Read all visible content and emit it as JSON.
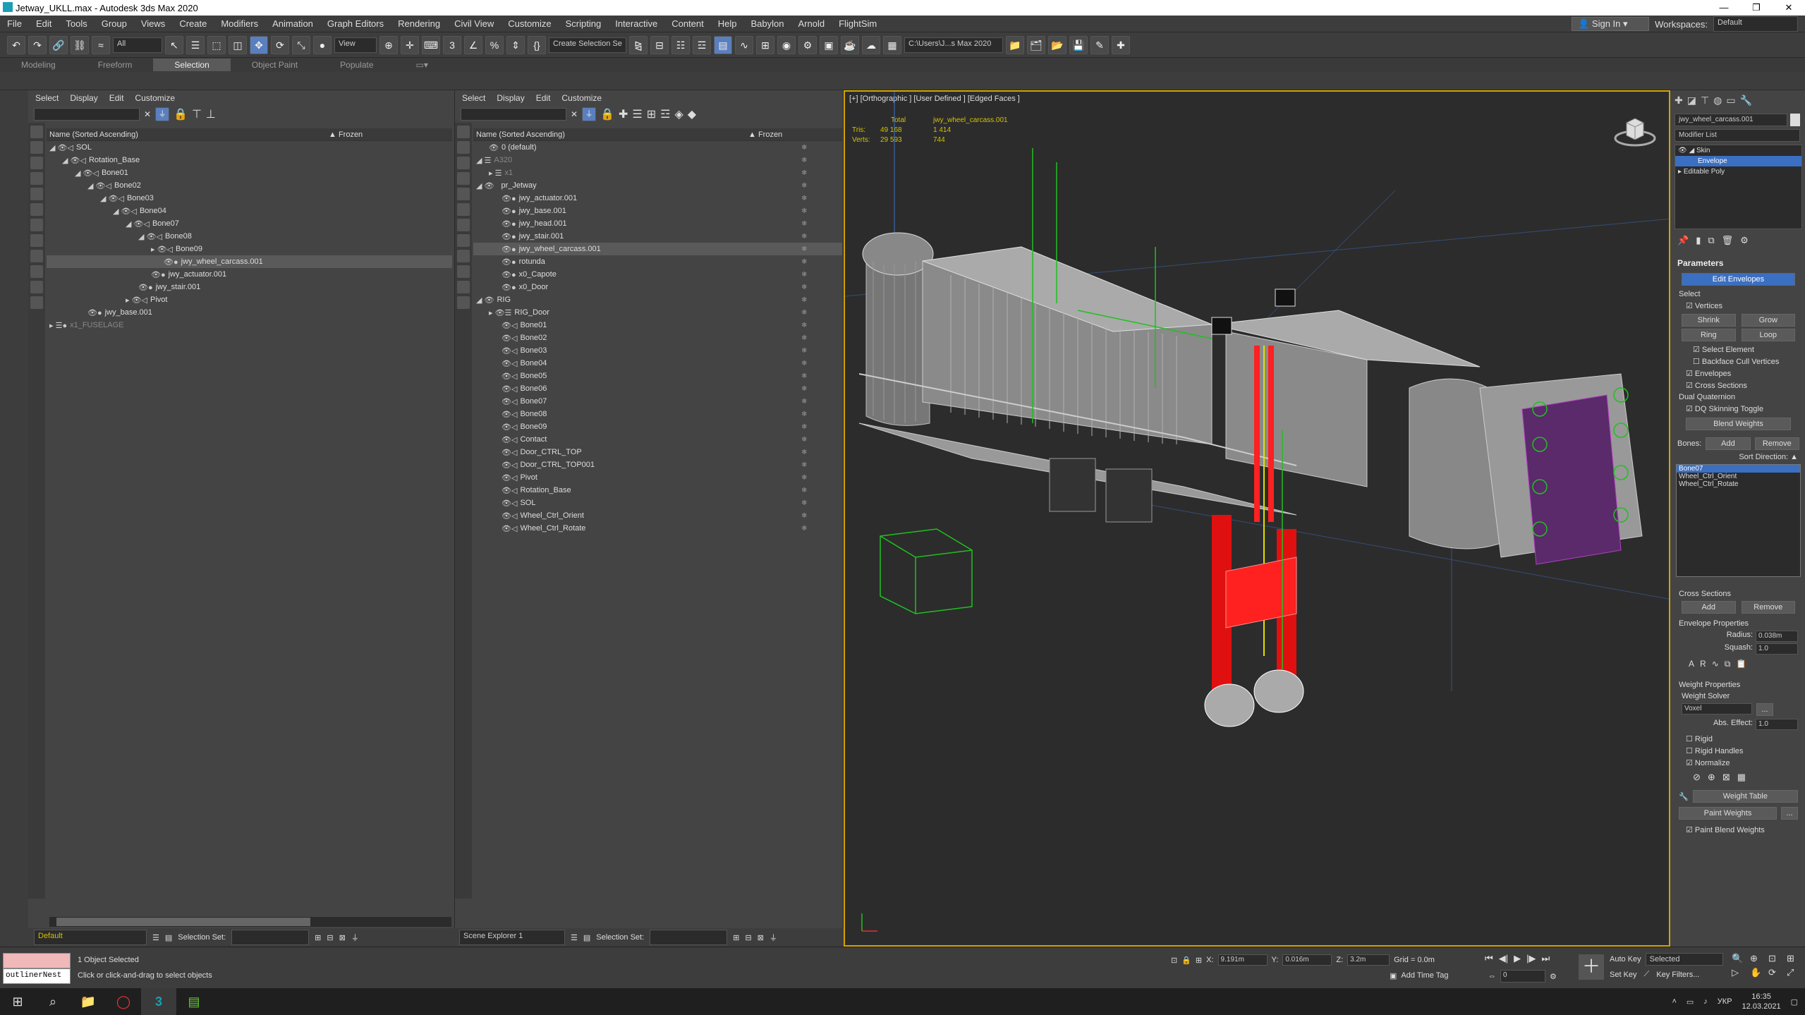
{
  "window": {
    "title": "Jetway_UKLL.max - Autodesk 3ds Max 2020"
  },
  "menu": [
    "File",
    "Edit",
    "Tools",
    "Group",
    "Views",
    "Create",
    "Modifiers",
    "Animation",
    "Graph Editors",
    "Rendering",
    "Civil View",
    "Customize",
    "Scripting",
    "Interactive",
    "Content",
    "Help",
    "Babylon",
    "Arnold",
    "FlightSim"
  ],
  "account": {
    "sign_in": "Sign In",
    "workspaces_label": "Workspaces:",
    "workspace": "Default"
  },
  "toolbar": {
    "filter": "All",
    "ref_coord": "View",
    "selection_set": "Create Selection Se",
    "project_path": "C:\\Users\\J...s Max 2020"
  },
  "ribbon": {
    "tabs": [
      "Modeling",
      "Freeform",
      "Selection",
      "Object Paint",
      "Populate"
    ],
    "active": "Selection"
  },
  "explorer_menu": [
    "Select",
    "Display",
    "Edit",
    "Customize"
  ],
  "explorer1": {
    "col_name": "Name (Sorted Ascending)",
    "col_frozen": "▲ Frozen",
    "rows": [
      {
        "label": "SOL"
      },
      {
        "label": "Rotation_Base"
      },
      {
        "label": "Bone01"
      },
      {
        "label": "Bone02"
      },
      {
        "label": "Bone03"
      },
      {
        "label": "Bone04"
      },
      {
        "label": "Bone07"
      },
      {
        "label": "Bone08"
      },
      {
        "label": "Bone09"
      },
      {
        "label": "jwy_wheel_carcass.001"
      },
      {
        "label": "jwy_actuator.001"
      },
      {
        "label": "jwy_stair.001"
      },
      {
        "label": "Pivot"
      },
      {
        "label": "jwy_base.001"
      },
      {
        "label": "x1_FUSELAGE"
      }
    ],
    "layer": "Default",
    "selection_set_label": "Selection Set:"
  },
  "explorer2": {
    "col_name": "Name (Sorted Ascending)",
    "col_frozen": "▲ Frozen",
    "rows": [
      {
        "label": "0 (default)"
      },
      {
        "label": "A320"
      },
      {
        "label": "x1"
      },
      {
        "label": "pr_Jetway"
      },
      {
        "label": "jwy_actuator.001"
      },
      {
        "label": "jwy_base.001"
      },
      {
        "label": "jwy_head.001"
      },
      {
        "label": "jwy_stair.001"
      },
      {
        "label": "jwy_wheel_carcass.001"
      },
      {
        "label": "rotunda"
      },
      {
        "label": "x0_Capote"
      },
      {
        "label": "x0_Door"
      },
      {
        "label": "RIG"
      },
      {
        "label": "RIG_Door"
      },
      {
        "label": "Bone01"
      },
      {
        "label": "Bone02"
      },
      {
        "label": "Bone03"
      },
      {
        "label": "Bone04"
      },
      {
        "label": "Bone05"
      },
      {
        "label": "Bone06"
      },
      {
        "label": "Bone07"
      },
      {
        "label": "Bone08"
      },
      {
        "label": "Bone09"
      },
      {
        "label": "Contact"
      },
      {
        "label": "Door_CTRL_TOP"
      },
      {
        "label": "Door_CTRL_TOP001"
      },
      {
        "label": "Pivot"
      },
      {
        "label": "Rotation_Base"
      },
      {
        "label": "SOL"
      },
      {
        "label": "Wheel_Ctrl_Orient"
      },
      {
        "label": "Wheel_Ctrl_Rotate"
      }
    ],
    "explorer_name": "Scene Explorer 1",
    "selection_set_label": "Selection Set:"
  },
  "viewport": {
    "label": "[+] [Orthographic ] [User Defined ] [Edged Faces ]",
    "stats": {
      "total": "Total",
      "object": "jwy_wheel_carcass.001",
      "tris_label": "Tris:",
      "tris_total": "49 168",
      "tris_obj": "1 414",
      "verts_label": "Verts:",
      "verts_total": "29 593",
      "verts_obj": "744"
    }
  },
  "command_panel": {
    "object_name": "jwy_wheel_carcass.001",
    "modifier_list": "Modifier List",
    "stack": [
      "Skin",
      "Envelope",
      "Editable Poly"
    ],
    "params": "Parameters",
    "edit_envelopes": "Edit Envelopes",
    "select": "Select",
    "vertices": "Vertices",
    "shrink": "Shrink",
    "grow": "Grow",
    "ring": "Ring",
    "loop": "Loop",
    "select_element": "Select Element",
    "backface": "Backface Cull Vertices",
    "envelopes": "Envelopes",
    "cross_sections": "Cross Sections",
    "dual_quat": "Dual Quaternion",
    "dq_toggle": "DQ Skinning Toggle",
    "blend_weights": "Blend Weights",
    "bones_label": "Bones:",
    "add": "Add",
    "remove": "Remove",
    "sort_direction": "Sort Direction:",
    "bones": [
      "Bone07",
      "Wheel_Ctrl_Orient",
      "Wheel_Ctrl_Rotate"
    ],
    "cs_title": "Cross Sections",
    "env_props": "Envelope Properties",
    "radius_label": "Radius:",
    "radius": "0.038m",
    "squash_label": "Squash:",
    "squash": "1.0",
    "weight_props": "Weight Properties",
    "weight_solver": "Weight Solver",
    "solver": "Voxel",
    "abs_effect_label": "Abs. Effect:",
    "abs_effect": "1.0",
    "rigid": "Rigid",
    "rigid_handles": "Rigid Handles",
    "normalize": "Normalize",
    "weight_table": "Weight Table",
    "paint_weights": "Paint Weights",
    "paint_blend": "Paint Blend Weights"
  },
  "status": {
    "maxscript": "outlinerNest",
    "objects_selected": "1 Object Selected",
    "hint": "Click or click-and-drag to select objects",
    "x_label": "X:",
    "x": "9.191m",
    "y_label": "Y:",
    "y": "0.016m",
    "z_label": "Z:",
    "z": "3.2m",
    "grid": "Grid = 0.0m",
    "add_time_tag": "Add Time Tag",
    "auto_key": "Auto Key",
    "set_key": "Set Key",
    "selected": "Selected",
    "key_filters": "Key Filters...",
    "frame": "0"
  },
  "taskbar": {
    "lang": "УКР",
    "time": "16:35",
    "date": "12.03.2021"
  }
}
